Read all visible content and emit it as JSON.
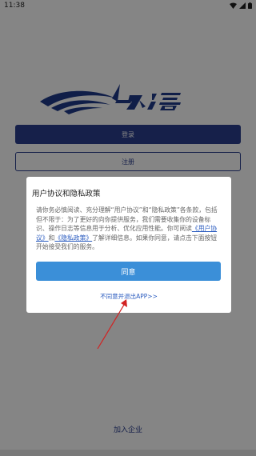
{
  "status_bar": {
    "time": "11:38"
  },
  "login": {
    "login_label": "登录",
    "register_label": "注册",
    "join_label": "加入企业"
  },
  "dialog": {
    "title": "用户协议和隐私政策",
    "body_part1": "请你务必慎阅读、充分理解“用户协议”和“隐私政策”各条款，包括但不限于：为了更好的向你提供服务，我们需要收集你的设备标识、操作日志等信息用于分析、优化应用性能。你可阅读",
    "link_user_agreement": "《用户协议》",
    "body_and": "和",
    "link_privacy": "《隐私政策》",
    "body_part2": "了解详细信息。如果你同意，请点击下面按钮开始接受我们的服务。",
    "agree_label": "同意",
    "disagree_label": "不同意并退出APP>>"
  },
  "colors": {
    "brand": "#2b3f8e",
    "accent": "#3b8fd8",
    "arrow": "#d22222"
  },
  "icons": {
    "signal": "cellular-signal-icon",
    "wifi": "wifi-icon",
    "battery": "battery-icon"
  }
}
